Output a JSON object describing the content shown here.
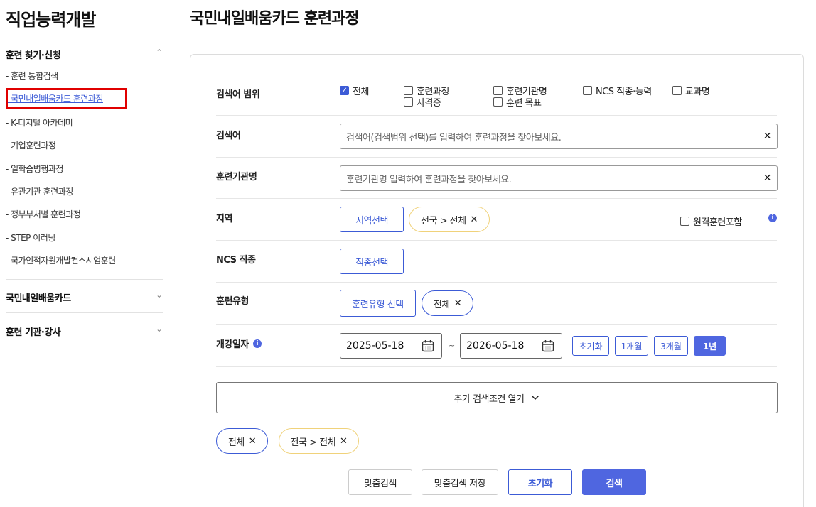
{
  "sidebar": {
    "title": "직업능력개발",
    "sections": [
      {
        "label": "훈련 찾기·신청",
        "expanded": true
      },
      {
        "label": "국민내일배움카드",
        "expanded": false
      },
      {
        "label": "훈련 기관·강사",
        "expanded": false
      }
    ],
    "items": [
      "- 훈련 통합검색",
      "- 국민내일배움카드 훈련과정",
      "- K-디지털 아카데미",
      "- 기업훈련과정",
      "- 일학습병행과정",
      "- 유관기관 훈련과정",
      "- 정부부처별 훈련과정",
      "- STEP 이러닝",
      "- 국가인적자원개발컨소시엄훈련"
    ],
    "active_item": "- 국민내일배움카드 훈련과정",
    "chev_up": "⌃",
    "chev_down": "⌄"
  },
  "main": {
    "title": "국민내일배움카드 훈련과정"
  },
  "form": {
    "scope_label": "검색어 범위",
    "scope_options": [
      {
        "label": "전체",
        "checked": true
      },
      {
        "label": "훈련과정",
        "checked": false
      },
      {
        "label": "훈련기관명",
        "checked": false
      },
      {
        "label": "NCS 직종·능력",
        "checked": false
      },
      {
        "label": "교과명",
        "checked": false
      },
      {
        "label": "자격증",
        "checked": false
      },
      {
        "label": "훈련 목표",
        "checked": false
      }
    ],
    "keyword_label": "검색어",
    "keyword_placeholder": "검색어(검색범위 선택)를 입력하여 훈련과정을 찾아보세요.",
    "institution_label": "훈련기관명",
    "institution_placeholder": "훈련기관명 입력하여 훈련과정을 찾아보세요.",
    "clear_glyph": "✕",
    "region_label": "지역",
    "region_button": "지역선택",
    "region_chip": "전국 > 전체",
    "remote_label": "원격훈련포함",
    "ncs_label": "NCS 직종",
    "ncs_button": "직종선택",
    "type_label": "훈련유형",
    "type_button": "훈련유형 선택",
    "type_chip": "전체",
    "date_label": "개강일자",
    "date_start": "2025-05-18",
    "date_end": "2026-05-18",
    "date_sep": "~",
    "period_buttons": [
      "초기화",
      "1개월",
      "3개월",
      "1년"
    ],
    "period_selected": "1년",
    "more_label": "추가 검색조건 열기",
    "selected_chips": [
      "전체",
      "전국 > 전체"
    ],
    "chip_close": "✕",
    "info_glyph": "i",
    "check_glyph": "✓"
  },
  "actions": {
    "custom_search": "맞춤검색",
    "save_custom": "맞춤검색 저장",
    "reset": "초기화",
    "search": "검색"
  },
  "colors": {
    "accent": "#3c5bd6",
    "accent_fill": "#4f66e0",
    "highlight_border": "#e00000",
    "chip_yellow": "#f0d27a"
  }
}
